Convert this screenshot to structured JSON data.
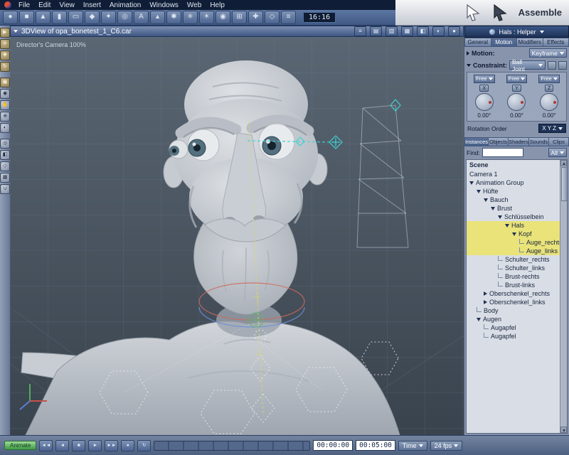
{
  "menubar": {
    "items": [
      "File",
      "Edit",
      "View",
      "Insert",
      "Animation",
      "Windows",
      "Web",
      "Help"
    ]
  },
  "toolbar": {
    "clock": "16:16",
    "icons": [
      {
        "name": "insert-sphere-icon",
        "glyph": "●"
      },
      {
        "name": "insert-cube-icon",
        "glyph": "■"
      },
      {
        "name": "insert-cone-icon",
        "glyph": "▲"
      },
      {
        "name": "insert-cylinder-icon",
        "glyph": "▮"
      },
      {
        "name": "insert-plane-icon",
        "glyph": "▭"
      },
      {
        "name": "insert-vertex-object-icon",
        "glyph": "◆"
      },
      {
        "name": "insert-spline-object-icon",
        "glyph": "✦"
      },
      {
        "name": "insert-metaball-icon",
        "glyph": "◎"
      },
      {
        "name": "insert-text-icon",
        "glyph": "A"
      },
      {
        "name": "insert-terrain-icon",
        "glyph": "▴"
      },
      {
        "name": "insert-particles-icon",
        "glyph": "✱"
      },
      {
        "name": "insert-fountain-icon",
        "glyph": "✳"
      },
      {
        "name": "insert-light-icon",
        "glyph": "☀"
      },
      {
        "name": "insert-camera-icon",
        "glyph": "◉"
      },
      {
        "name": "insert-group-icon",
        "glyph": "⊞"
      },
      {
        "name": "insert-bone-icon",
        "glyph": "✚"
      },
      {
        "name": "insert-target-helper-icon",
        "glyph": "◇"
      },
      {
        "name": "scene-wizard-icon",
        "glyph": "≡"
      }
    ]
  },
  "header_right": {
    "room_label": "Assemble"
  },
  "left_tools": {
    "icons": [
      {
        "name": "select-tool-icon",
        "glyph": "▶"
      },
      {
        "name": "universal-manipulator-icon",
        "glyph": "✛"
      },
      {
        "name": "move-tool-icon",
        "glyph": "✚"
      },
      {
        "name": "rotate-tool-icon",
        "glyph": "↻"
      },
      {
        "name": "scale-tool-icon",
        "glyph": "▣"
      },
      {
        "name": "camera-dolly-icon",
        "glyph": "◉"
      },
      {
        "name": "camera-pan-icon",
        "glyph": "✋"
      },
      {
        "name": "camera-track-icon",
        "glyph": "⊕"
      },
      {
        "name": "camera-bank-icon",
        "glyph": "◐"
      },
      {
        "name": "zoom-tool-icon",
        "glyph": "◎"
      },
      {
        "name": "render-preview-icon",
        "glyph": "◧"
      },
      {
        "name": "wireframe-toggle-icon",
        "glyph": "◇"
      },
      {
        "name": "grid-toggle-icon",
        "glyph": "▦"
      },
      {
        "name": "magnet-snap-icon",
        "glyph": "∪"
      }
    ]
  },
  "viewport": {
    "title": "3DView of opa_bonetest_1_C6.car",
    "camera_label": "Director's Camera 100%",
    "title_icons": [
      {
        "name": "view-menu-icon",
        "glyph": "≡"
      },
      {
        "name": "wireframe-mode-icon",
        "glyph": "▤"
      },
      {
        "name": "lit-wireframe-mode-icon",
        "glyph": "▥"
      },
      {
        "name": "flat-shade-mode-icon",
        "glyph": "▦"
      },
      {
        "name": "smooth-shade-mode-icon",
        "glyph": "◧"
      },
      {
        "name": "textured-mode-icon",
        "glyph": "◐"
      },
      {
        "name": "full-render-mode-icon",
        "glyph": "●"
      }
    ]
  },
  "properties": {
    "title": "Hals : Helper",
    "tabs": [
      "General",
      "Motion",
      "Modifiers",
      "Effects"
    ],
    "active_tab": "Motion",
    "motion_label": "Motion:",
    "motion_value": "Keyframe",
    "constraint_label": "Constraint:",
    "constraint_value": "Ball Joint",
    "axes": [
      {
        "label": "X",
        "mode": "Free",
        "value": "0.00°"
      },
      {
        "label": "Y",
        "mode": "Free",
        "value": "0.00°"
      },
      {
        "label": "Z",
        "mode": "Free",
        "value": "0.00°"
      }
    ],
    "rotation_order_label": "Rotation Order",
    "rotation_order_value": "X Y Z"
  },
  "browser": {
    "tabs": [
      "Instances",
      "Objects",
      "Shaders",
      "Sounds",
      "Clips"
    ],
    "active_tab": "Instances",
    "find_label": "Find:",
    "filter_value": "All",
    "root_label": "Scene",
    "tree": [
      {
        "label": "Camera 1",
        "indent": 0,
        "expandable": false,
        "selected": false
      },
      {
        "label": "Animation Group",
        "indent": 0,
        "expandable": true,
        "selected": false
      },
      {
        "label": "Hüfte",
        "indent": 1,
        "expandable": true,
        "selected": false
      },
      {
        "label": "Bauch",
        "indent": 2,
        "expandable": true,
        "selected": false
      },
      {
        "label": "Brust",
        "indent": 3,
        "expandable": true,
        "selected": false
      },
      {
        "label": "Schlüsselbein",
        "indent": 4,
        "expandable": true,
        "selected": false
      },
      {
        "label": "Hals",
        "indent": 5,
        "expandable": true,
        "selected": true
      },
      {
        "label": "Kopf",
        "indent": 6,
        "expandable": true,
        "selected": true
      },
      {
        "label": "Auge_rechts",
        "indent": 7,
        "expandable": false,
        "selected": true
      },
      {
        "label": "Auge_links",
        "indent": 7,
        "expandable": false,
        "selected": true
      },
      {
        "label": "Schulter_rechts",
        "indent": 4,
        "expandable": false,
        "selected": false
      },
      {
        "label": "Schulter_links",
        "indent": 4,
        "expandable": false,
        "selected": false
      },
      {
        "label": "Brust-rechts",
        "indent": 4,
        "expandable": false,
        "selected": false
      },
      {
        "label": "Brust-links",
        "indent": 4,
        "expandable": false,
        "selected": false
      },
      {
        "label": "Oberschenkel_rechts",
        "indent": 2,
        "expandable": true,
        "selected": false
      },
      {
        "label": "Oberschenkel_links",
        "indent": 2,
        "expandable": true,
        "selected": false
      },
      {
        "label": "Body",
        "indent": 1,
        "expandable": false,
        "selected": false
      },
      {
        "label": "Augen",
        "indent": 1,
        "expandable": true,
        "selected": false
      },
      {
        "label": "Augapfel",
        "indent": 2,
        "expandable": false,
        "selected": false
      },
      {
        "label": "Augapfel",
        "indent": 2,
        "expandable": false,
        "selected": false
      }
    ]
  },
  "timeline": {
    "animate_label": "Animate",
    "transport": [
      {
        "name": "jump-start-icon",
        "glyph": "◄◄"
      },
      {
        "name": "frame-back-icon",
        "glyph": "◄"
      },
      {
        "name": "stop-icon",
        "glyph": "■"
      },
      {
        "name": "play-icon",
        "glyph": "►"
      },
      {
        "name": "jump-end-icon",
        "glyph": "►►"
      },
      {
        "name": "record-icon",
        "glyph": "●"
      },
      {
        "name": "loop-icon",
        "glyph": "↻"
      }
    ],
    "current_time": "00:00:00",
    "end_time": "00:05:00",
    "unit_label": "Time",
    "fps_label": "24 fps"
  },
  "colors": {
    "selection_yellow": "#e9e37a",
    "ui_chrome_blue": "#5d77a3",
    "viewport_bg": "#46525e",
    "bone_cyan": "#3fd2d2",
    "bone_yellow": "#d9d75e"
  }
}
